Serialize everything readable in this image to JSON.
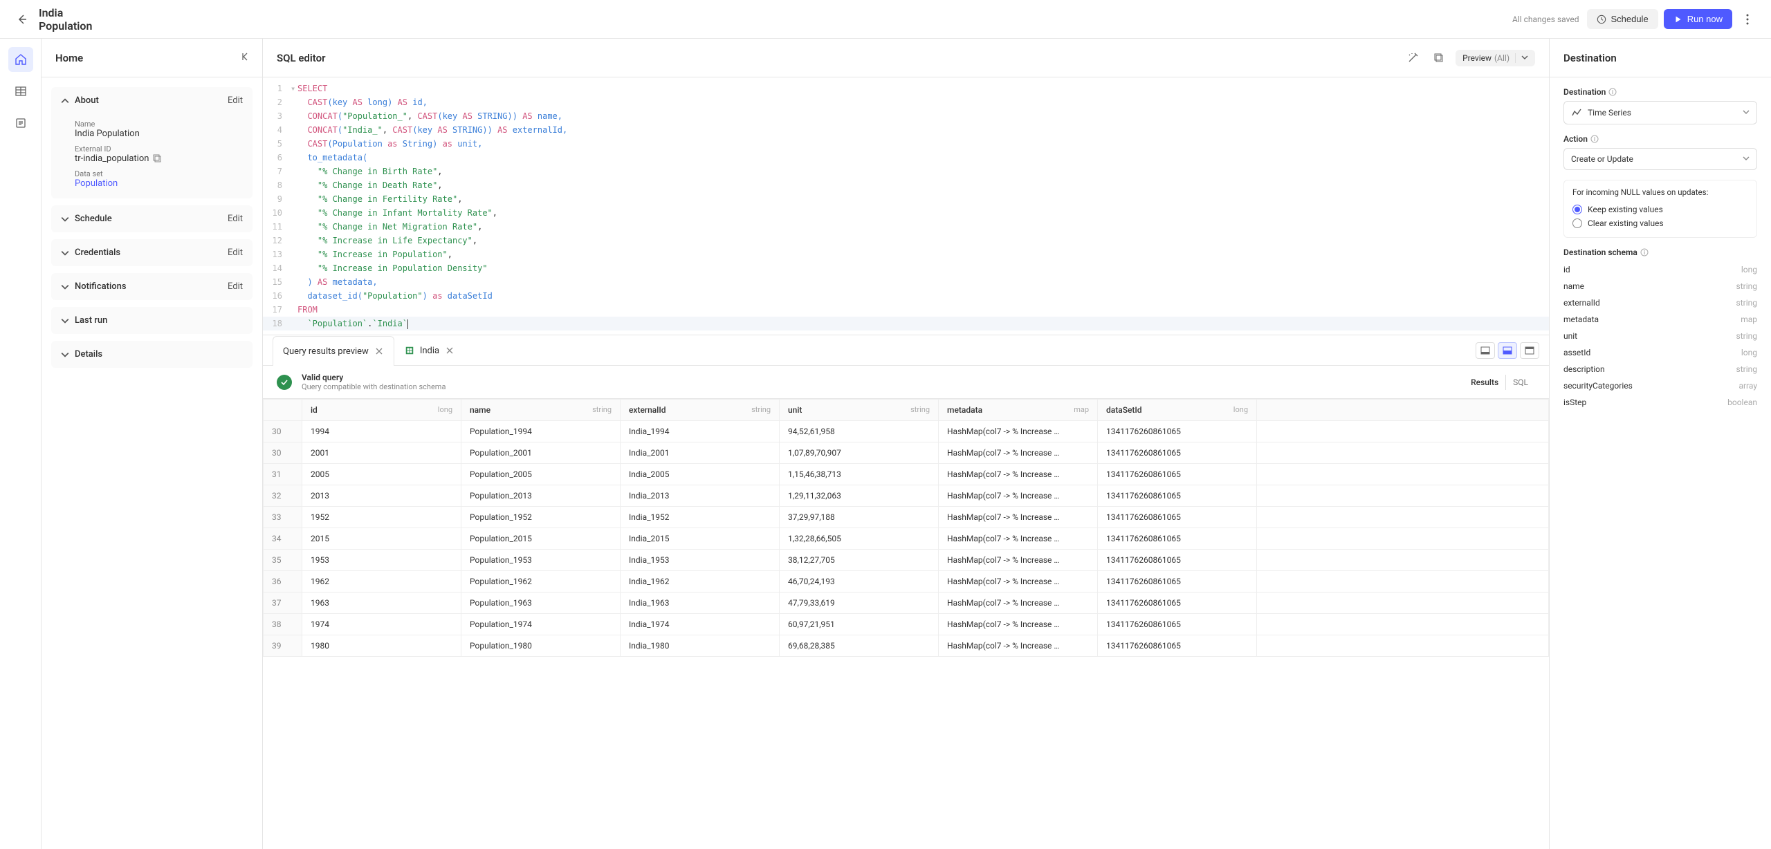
{
  "header": {
    "title": "India Population",
    "save_status": "All changes saved",
    "schedule_label": "Schedule",
    "run_label": "Run now"
  },
  "home_panel": {
    "title": "Home",
    "edit_label": "Edit",
    "sections": {
      "about": {
        "label": "About",
        "name_label": "Name",
        "name_value": "India Population",
        "extid_label": "External ID",
        "extid_value": "tr-india_population",
        "dataset_label": "Data set",
        "dataset_value": "Population"
      },
      "schedule": {
        "label": "Schedule"
      },
      "credentials": {
        "label": "Credentials"
      },
      "notifications": {
        "label": "Notifications"
      },
      "last_run": {
        "label": "Last run"
      },
      "details": {
        "label": "Details"
      }
    }
  },
  "editor": {
    "title": "SQL editor",
    "preview_label": "Preview",
    "preview_scope": "(All)"
  },
  "sql_tokens": [
    [
      {
        "t": "SELECT",
        "c": "kw2"
      }
    ],
    [
      {
        "t": "  ",
        "c": "plain"
      },
      {
        "t": "CAST",
        "c": "fn"
      },
      {
        "t": "(",
        "c": "paren"
      },
      {
        "t": "key ",
        "c": "id"
      },
      {
        "t": "AS",
        "c": "kw2"
      },
      {
        "t": " ",
        "c": "plain"
      },
      {
        "t": "long",
        "c": "type"
      },
      {
        "t": ")",
        "c": "paren"
      },
      {
        "t": " ",
        "c": "plain"
      },
      {
        "t": "AS",
        "c": "kw2"
      },
      {
        "t": " id,",
        "c": "id"
      }
    ],
    [
      {
        "t": "  ",
        "c": "plain"
      },
      {
        "t": "CONCAT",
        "c": "fn"
      },
      {
        "t": "(",
        "c": "paren"
      },
      {
        "t": "\"Population_\"",
        "c": "str"
      },
      {
        "t": ", ",
        "c": "plain"
      },
      {
        "t": "CAST",
        "c": "fn"
      },
      {
        "t": "(",
        "c": "paren"
      },
      {
        "t": "key ",
        "c": "id"
      },
      {
        "t": "AS",
        "c": "kw2"
      },
      {
        "t": " STRING",
        "c": "type"
      },
      {
        "t": "))",
        "c": "paren"
      },
      {
        "t": " ",
        "c": "plain"
      },
      {
        "t": "AS",
        "c": "kw2"
      },
      {
        "t": " name,",
        "c": "id"
      }
    ],
    [
      {
        "t": "  ",
        "c": "plain"
      },
      {
        "t": "CONCAT",
        "c": "fn"
      },
      {
        "t": "(",
        "c": "paren"
      },
      {
        "t": "\"India_\"",
        "c": "str"
      },
      {
        "t": ", ",
        "c": "plain"
      },
      {
        "t": "CAST",
        "c": "fn"
      },
      {
        "t": "(",
        "c": "paren"
      },
      {
        "t": "key ",
        "c": "id"
      },
      {
        "t": "AS",
        "c": "kw2"
      },
      {
        "t": " STRING",
        "c": "type"
      },
      {
        "t": "))",
        "c": "paren"
      },
      {
        "t": " ",
        "c": "plain"
      },
      {
        "t": "AS",
        "c": "kw2"
      },
      {
        "t": " externalId,",
        "c": "id"
      }
    ],
    [
      {
        "t": "  ",
        "c": "plain"
      },
      {
        "t": "CAST",
        "c": "fn"
      },
      {
        "t": "(",
        "c": "paren"
      },
      {
        "t": "Population ",
        "c": "id"
      },
      {
        "t": "as",
        "c": "kw2"
      },
      {
        "t": " String",
        "c": "type"
      },
      {
        "t": ")",
        "c": "paren"
      },
      {
        "t": " ",
        "c": "plain"
      },
      {
        "t": "as",
        "c": "kw2"
      },
      {
        "t": " unit,",
        "c": "id"
      }
    ],
    [
      {
        "t": "  ",
        "c": "plain"
      },
      {
        "t": "to_metadata",
        "c": "id"
      },
      {
        "t": "(",
        "c": "paren"
      }
    ],
    [
      {
        "t": "    ",
        "c": "plain"
      },
      {
        "t": "\"% Change in Birth Rate\"",
        "c": "str"
      },
      {
        "t": ",",
        "c": "plain"
      }
    ],
    [
      {
        "t": "    ",
        "c": "plain"
      },
      {
        "t": "\"% Change in Death Rate\"",
        "c": "str"
      },
      {
        "t": ",",
        "c": "plain"
      }
    ],
    [
      {
        "t": "    ",
        "c": "plain"
      },
      {
        "t": "\"% Change in Fertility Rate\"",
        "c": "str"
      },
      {
        "t": ",",
        "c": "plain"
      }
    ],
    [
      {
        "t": "    ",
        "c": "plain"
      },
      {
        "t": "\"% Change in Infant Mortality Rate\"",
        "c": "str"
      },
      {
        "t": ",",
        "c": "plain"
      }
    ],
    [
      {
        "t": "    ",
        "c": "plain"
      },
      {
        "t": "\"% Change in Net Migration Rate\"",
        "c": "str"
      },
      {
        "t": ",",
        "c": "plain"
      }
    ],
    [
      {
        "t": "    ",
        "c": "plain"
      },
      {
        "t": "\"% Increase in Life Expectancy\"",
        "c": "str"
      },
      {
        "t": ",",
        "c": "plain"
      }
    ],
    [
      {
        "t": "    ",
        "c": "plain"
      },
      {
        "t": "\"% Increase in Population\"",
        "c": "str"
      },
      {
        "t": ",",
        "c": "plain"
      }
    ],
    [
      {
        "t": "    ",
        "c": "plain"
      },
      {
        "t": "\"% Increase in Population Density\"",
        "c": "str"
      }
    ],
    [
      {
        "t": "  ",
        "c": "plain"
      },
      {
        "t": ")",
        "c": "paren"
      },
      {
        "t": " ",
        "c": "plain"
      },
      {
        "t": "AS",
        "c": "kw2"
      },
      {
        "t": " metadata,",
        "c": "id"
      }
    ],
    [
      {
        "t": "  ",
        "c": "plain"
      },
      {
        "t": "dataset_id",
        "c": "id"
      },
      {
        "t": "(",
        "c": "paren"
      },
      {
        "t": "\"Population\"",
        "c": "str"
      },
      {
        "t": ")",
        "c": "paren"
      },
      {
        "t": " ",
        "c": "plain"
      },
      {
        "t": "as",
        "c": "kw2"
      },
      {
        "t": " dataSetId",
        "c": "id"
      }
    ],
    [
      {
        "t": "FROM",
        "c": "kw2"
      }
    ],
    [
      {
        "t": "  ",
        "c": "plain"
      },
      {
        "t": "`Population`",
        "c": "str"
      },
      {
        "t": ".",
        "c": "plain"
      },
      {
        "t": "`India`",
        "c": "str"
      }
    ]
  ],
  "results": {
    "tab1_label": "Query results preview",
    "tab2_label": "India",
    "valid_title": "Valid query",
    "valid_sub": "Query compatible with destination schema",
    "mode_results": "Results",
    "mode_sql": "SQL",
    "columns": [
      {
        "name": "id",
        "type": "long"
      },
      {
        "name": "name",
        "type": "string"
      },
      {
        "name": "externalId",
        "type": "string"
      },
      {
        "name": "unit",
        "type": "string"
      },
      {
        "name": "metadata",
        "type": "map"
      },
      {
        "name": "dataSetId",
        "type": "long"
      }
    ],
    "rows": [
      {
        "n": 30,
        "id": "1994",
        "name": "Population_1994",
        "externalId": "India_1994",
        "unit": "94,52,61,958",
        "metadata": "HashMap(col7 -> % Increase …",
        "dataSetId": "1341176260861065"
      },
      {
        "n": 30,
        "id": "2001",
        "name": "Population_2001",
        "externalId": "India_2001",
        "unit": "1,07,89,70,907",
        "metadata": "HashMap(col7 -> % Increase …",
        "dataSetId": "1341176260861065"
      },
      {
        "n": 31,
        "id": "2005",
        "name": "Population_2005",
        "externalId": "India_2005",
        "unit": "1,15,46,38,713",
        "metadata": "HashMap(col7 -> % Increase …",
        "dataSetId": "1341176260861065"
      },
      {
        "n": 32,
        "id": "2013",
        "name": "Population_2013",
        "externalId": "India_2013",
        "unit": "1,29,11,32,063",
        "metadata": "HashMap(col7 -> % Increase …",
        "dataSetId": "1341176260861065"
      },
      {
        "n": 33,
        "id": "1952",
        "name": "Population_1952",
        "externalId": "India_1952",
        "unit": "37,29,97,188",
        "metadata": "HashMap(col7 -> % Increase …",
        "dataSetId": "1341176260861065"
      },
      {
        "n": 34,
        "id": "2015",
        "name": "Population_2015",
        "externalId": "India_2015",
        "unit": "1,32,28,66,505",
        "metadata": "HashMap(col7 -> % Increase …",
        "dataSetId": "1341176260861065"
      },
      {
        "n": 35,
        "id": "1953",
        "name": "Population_1953",
        "externalId": "India_1953",
        "unit": "38,12,27,705",
        "metadata": "HashMap(col7 -> % Increase …",
        "dataSetId": "1341176260861065"
      },
      {
        "n": 36,
        "id": "1962",
        "name": "Population_1962",
        "externalId": "India_1962",
        "unit": "46,70,24,193",
        "metadata": "HashMap(col7 -> % Increase …",
        "dataSetId": "1341176260861065"
      },
      {
        "n": 37,
        "id": "1963",
        "name": "Population_1963",
        "externalId": "India_1963",
        "unit": "47,79,33,619",
        "metadata": "HashMap(col7 -> % Increase …",
        "dataSetId": "1341176260861065"
      },
      {
        "n": 38,
        "id": "1974",
        "name": "Population_1974",
        "externalId": "India_1974",
        "unit": "60,97,21,951",
        "metadata": "HashMap(col7 -> % Increase …",
        "dataSetId": "1341176260861065"
      },
      {
        "n": 39,
        "id": "1980",
        "name": "Population_1980",
        "externalId": "India_1980",
        "unit": "69,68,28,385",
        "metadata": "HashMap(col7 -> % Increase …",
        "dataSetId": "1341176260861065"
      }
    ]
  },
  "destination": {
    "title": "Destination",
    "dest_label": "Destination",
    "dest_value": "Time Series",
    "action_label": "Action",
    "action_value": "Create or Update",
    "null_title": "For incoming NULL values on updates:",
    "null_opt1": "Keep existing values",
    "null_opt2": "Clear existing values",
    "schema_label": "Destination schema",
    "schema": [
      {
        "name": "id",
        "type": "long"
      },
      {
        "name": "name",
        "type": "string"
      },
      {
        "name": "externalId",
        "type": "string"
      },
      {
        "name": "metadata",
        "type": "map"
      },
      {
        "name": "unit",
        "type": "string"
      },
      {
        "name": "assetId",
        "type": "long"
      },
      {
        "name": "description",
        "type": "string"
      },
      {
        "name": "securityCategories",
        "type": "array"
      },
      {
        "name": "isStep",
        "type": "boolean"
      }
    ]
  }
}
